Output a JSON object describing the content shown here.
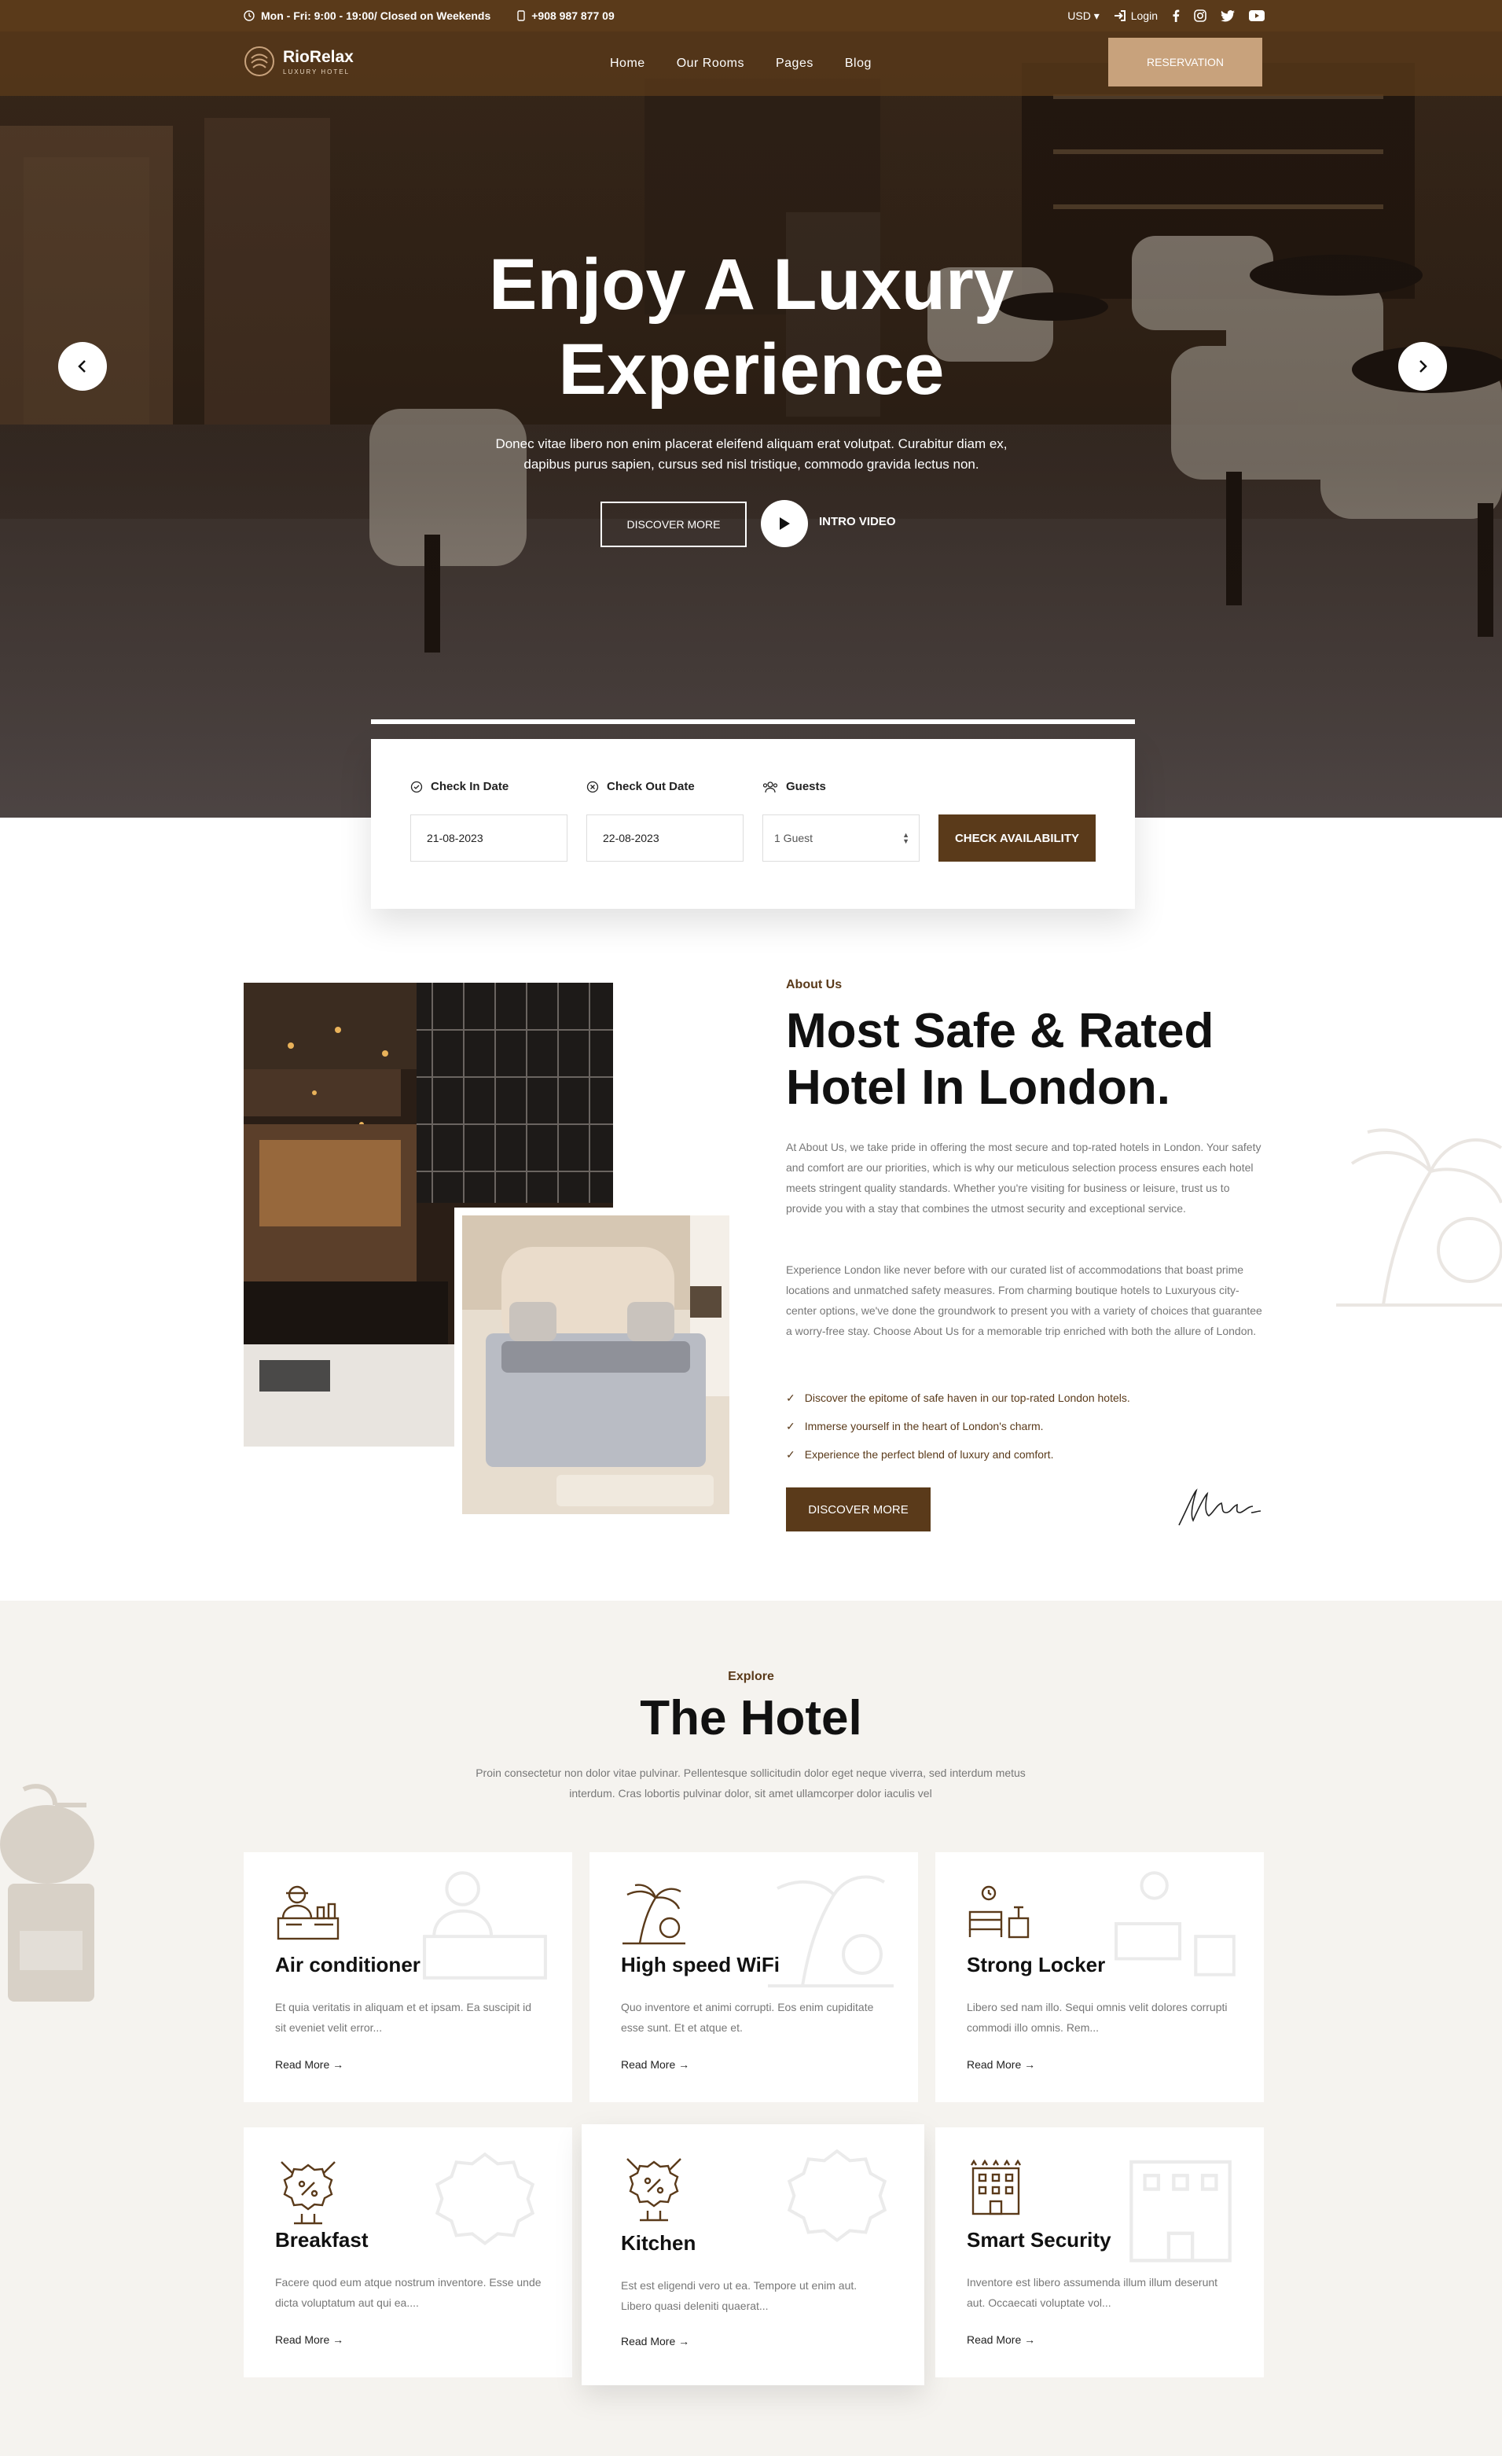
{
  "topbar": {
    "hours": "Mon - Fri: 9:00 - 19:00/ Closed on Weekends",
    "phone": "+908 987 877 09",
    "currency": "USD",
    "login": "Login"
  },
  "brand": {
    "name": "RioRelax",
    "tagline": "LUXURY HOTEL",
    "accent": "#5a3a1a",
    "gold": "#c8a27c"
  },
  "nav": {
    "items": [
      "Home",
      "Our Rooms",
      "Pages",
      "Blog"
    ],
    "cta": "RESERVATION"
  },
  "hero": {
    "title_line1": "Enjoy A Luxury",
    "title_line2": "Experience",
    "text_line1": "Donec vitae libero non enim placerat eleifend aliquam erat volutpat. Curabitur diam ex,",
    "text_line2": "dapibus purus sapien, cursus sed nisl tristique, commodo gravida lectus non.",
    "discover": "DISCOVER MORE",
    "intro": "INTRO VIDEO"
  },
  "booking": {
    "checkin_label": "Check In Date",
    "checkin_value": "21-08-2023",
    "checkout_label": "Check Out Date",
    "checkout_value": "22-08-2023",
    "guests_label": "Guests",
    "guests_value": "1 Guest",
    "submit": "CHECK AVAILABILITY"
  },
  "about": {
    "tag": "About Us",
    "title_line1": "Most Safe & Rated",
    "title_line2": "Hotel In London.",
    "para1": "At About Us, we take pride in offering the most secure and top-rated hotels in London. Your safety and comfort are our priorities, which is why our meticulous selection process ensures each hotel meets stringent quality standards. Whether you're visiting for business or leisure, trust us to provide you with a stay that combines the utmost security and exceptional service.",
    "para2": "Experience London like never before with our curated list of accommodations that boast prime locations and unmatched safety measures. From charming boutique hotels to Luxuryous city-center options, we've done the groundwork to present you with a variety of choices that guarantee a worry-free stay. Choose About Us for a memorable trip enriched with both the allure of London.",
    "list": [
      "Discover the epitome of safe haven in our top-rated London hotels.",
      "Immerse yourself in the heart of London's charm.",
      "Experience the perfect blend of luxury and comfort."
    ],
    "button": "DISCOVER MORE"
  },
  "explore": {
    "tag": "Explore",
    "title": "The Hotel",
    "text_line1": "Proin consectetur non dolor vitae pulvinar. Pellentesque sollicitudin dolor eget neque viverra, sed interdum metus",
    "text_line2": "interdum. Cras lobortis pulvinar dolor, sit amet ullamcorper dolor iaculis vel",
    "cards": [
      {
        "icon": "receptionist-icon",
        "title": "Air conditioner",
        "text": "Et quia veritatis in aliquam et et ipsam. Ea suscipit id sit eveniet velit error...",
        "link": "Read More"
      },
      {
        "icon": "palm-beach-icon",
        "title": "High speed WiFi",
        "text": "Quo inventore et animi corrupti. Eos enim cupiditate esse sunt. Et et atque et.",
        "link": "Read More"
      },
      {
        "icon": "bedroom-clock-icon",
        "title": "Strong Locker",
        "text": "Libero sed nam illo. Sequi omnis velit dolores corrupti commodi illo omnis. Rem...",
        "link": "Read More"
      },
      {
        "icon": "discount-badge-icon",
        "title": "Breakfast",
        "text": "Facere quod eum atque nostrum inventore. Esse unde dicta voluptatum aut qui ea....",
        "link": "Read More"
      },
      {
        "icon": "discount-badge-icon",
        "title": "Kitchen",
        "text": "Est est eligendi vero ut ea. Tempore ut enim aut. Libero quasi deleniti quaerat...",
        "link": "Read More"
      },
      {
        "icon": "hotel-building-icon",
        "title": "Smart Security",
        "text": "Inventore est libero assumenda illum illum deserunt aut. Occaecati voluptate vol...",
        "link": "Read More"
      }
    ]
  }
}
